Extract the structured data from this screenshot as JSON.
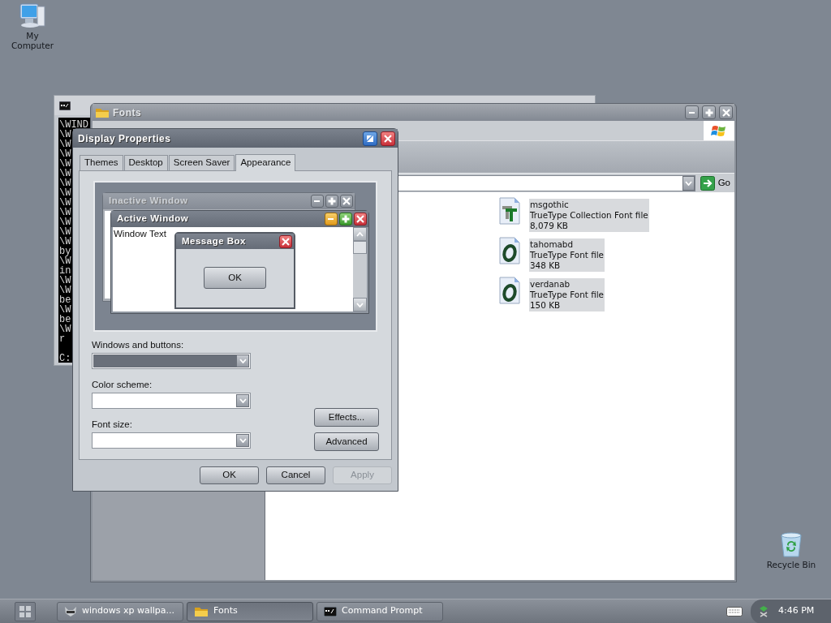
{
  "desktop_icons": [
    {
      "kind": "computer",
      "label": "My Computer"
    },
    {
      "kind": "bin",
      "label": "Recycle Bin"
    }
  ],
  "command_prompt": {
    "output_lines": [
      "\\WIND",
      "\\W",
      "\\W",
      "\\W",
      "\\W",
      "\\W",
      "\\W",
      "\\W",
      "\\W",
      "\\W",
      "\\W",
      "\\W",
      "\\W",
      "by",
      "\\W",
      "in",
      "\\W",
      "\\W",
      "be",
      "\\W",
      "be",
      "\\W",
      "r"
    ],
    "prompt": "C:"
  },
  "fonts_window": {
    "title": "Fonts",
    "go_label": "Go",
    "files": [
      {
        "kind": "collection",
        "name": "msgothic",
        "type": "TrueType Collection Font file",
        "size": "8,079 KB",
        "selected": true
      },
      {
        "kind": "font",
        "name": "tahomabd",
        "type": "TrueType Font file",
        "size": "348 KB",
        "selected": true
      },
      {
        "kind": "font",
        "name": "verdanab",
        "type": "TrueType Font file",
        "size": "150 KB",
        "selected": true
      }
    ]
  },
  "display_properties": {
    "title": "Display Properties",
    "tabs": [
      {
        "label": "Themes",
        "selected": false
      },
      {
        "label": "Desktop",
        "selected": false
      },
      {
        "label": "Screen Saver",
        "selected": false
      },
      {
        "label": "Appearance",
        "selected": true
      }
    ],
    "preview": {
      "inactive_window": {
        "title": "Inactive Window"
      },
      "active_window": {
        "title": "Active Window",
        "text": "Window Text"
      },
      "message_box": {
        "title": "Message Box",
        "button": "OK"
      }
    },
    "fields": [
      {
        "label": "Windows and buttons:",
        "highlighted": true
      },
      {
        "label": "Color scheme:",
        "highlighted": false
      },
      {
        "label": "Font size:",
        "highlighted": false
      }
    ],
    "side_buttons": [
      "Effects...",
      "Advanced"
    ],
    "buttons": [
      {
        "label": "OK",
        "disabled": false
      },
      {
        "label": "Cancel",
        "disabled": false
      },
      {
        "label": "Apply",
        "disabled": true
      }
    ]
  },
  "taskbar": {
    "tasks": [
      {
        "kind": "animal",
        "label": "windows xp wallpa...",
        "selected": false
      },
      {
        "kind": "folder",
        "label": "Fonts",
        "selected": true
      },
      {
        "kind": "console",
        "label": "Command Prompt",
        "selected": false
      }
    ],
    "clock": "4:46 PM"
  }
}
